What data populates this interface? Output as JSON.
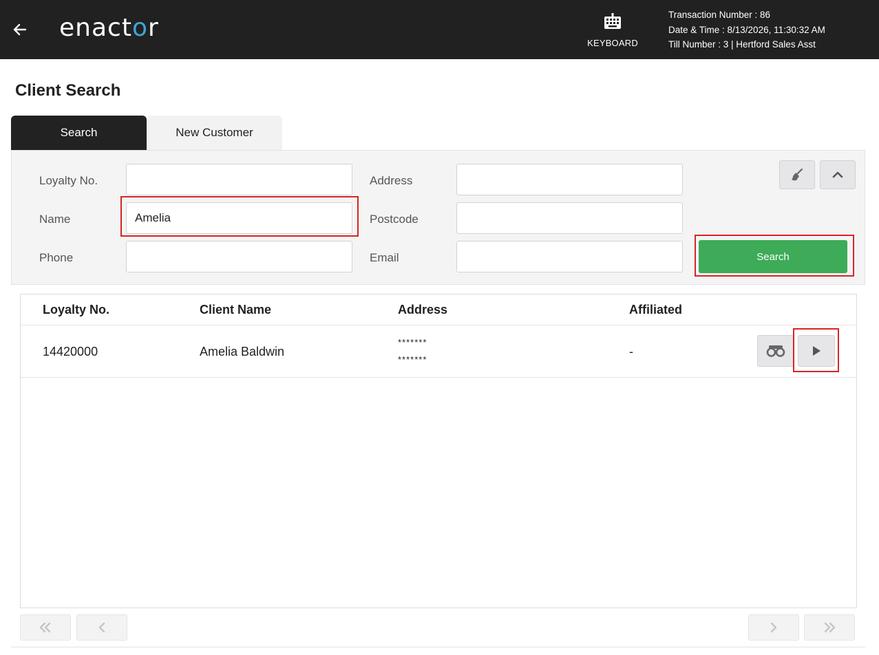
{
  "header": {
    "logo_prefix": "enact",
    "logo_accent": "o",
    "logo_suffix": "r",
    "keyboard_label": "KEYBOARD",
    "transaction_line": "Transaction Number : 86",
    "datetime_line": "Date & Time : 8/13/2026, 11:30:32 AM",
    "till_line": "Till Number : 3  |  Hertford Sales Asst"
  },
  "page": {
    "title": "Client Search"
  },
  "tabs": [
    {
      "label": "Search",
      "active": true
    },
    {
      "label": "New Customer",
      "active": false
    }
  ],
  "form": {
    "loyalty_label": "Loyalty No.",
    "loyalty_value": "",
    "name_label": "Name",
    "name_value": "Amelia",
    "phone_label": "Phone",
    "phone_value": "",
    "address_label": "Address",
    "address_value": "",
    "postcode_label": "Postcode",
    "postcode_value": "",
    "email_label": "Email",
    "email_value": "",
    "search_label": "Search"
  },
  "table": {
    "columns": [
      "Loyalty No.",
      "Client Name",
      "Address",
      "Affiliated"
    ],
    "rows": [
      {
        "loyalty": "14420000",
        "name": "Amelia Baldwin",
        "address_line1": "*******",
        "address_line2": "*******",
        "affiliated": "-"
      }
    ]
  },
  "icons": {
    "back": "arrow-left-icon",
    "keyboard": "keyboard-icon",
    "clear": "broom-icon",
    "collapse": "chevron-up-icon",
    "view": "binoculars-icon",
    "select": "play-icon",
    "first": "double-chevron-left-icon",
    "prev": "chevron-left-icon",
    "next": "chevron-right-icon",
    "last": "double-chevron-right-icon"
  },
  "colors": {
    "header_bg": "#212121",
    "search_button": "#3dab57",
    "highlight": "#d62424",
    "logo_accent": "#3fa4d8"
  }
}
